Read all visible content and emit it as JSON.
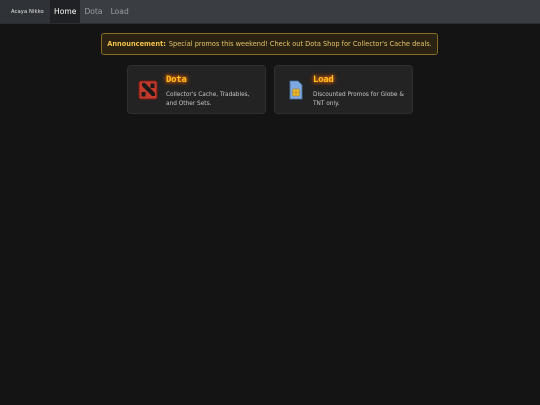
{
  "nav": {
    "brand": "Acaya Nikko",
    "items": [
      {
        "label": "Home",
        "active": true
      },
      {
        "label": "Dota",
        "active": false
      },
      {
        "label": "Load",
        "active": false
      }
    ]
  },
  "announcement": {
    "label": "Announcement:",
    "text": "Special promos this weekend! Check out Dota Shop for Collector's Cache deals."
  },
  "cards": [
    {
      "title": "Dota",
      "description": "Collector's Cache, Tradables, and Other Sets.",
      "icon": "dota-logo-icon"
    },
    {
      "title": "Load",
      "description": "Discounted Promos for Globe & TNT only.",
      "icon": "sim-card-icon"
    }
  ],
  "colors": {
    "background": "#141414",
    "navbar": "#3a3d42",
    "accent": "#ffbf1f",
    "announce_border": "#8a6a1f"
  }
}
